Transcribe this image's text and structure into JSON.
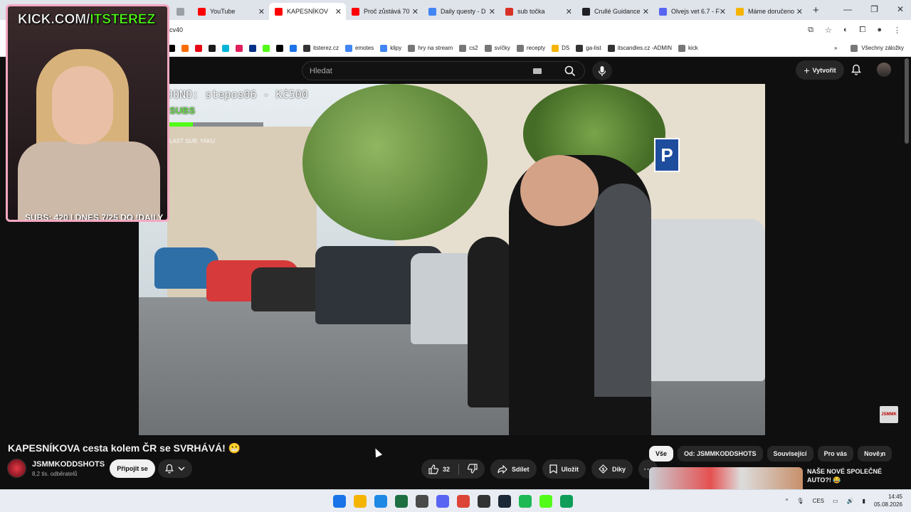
{
  "browser": {
    "tabs": [
      {
        "title": "",
        "favicon_color": "#9aa0a6"
      },
      {
        "title": "YouTube",
        "favicon_color": "#ff0000"
      },
      {
        "title": "KAPESNÍKOV",
        "favicon_color": "#ff0000",
        "active": true
      },
      {
        "title": "Proč zůstává 70",
        "favicon_color": "#ff0000"
      },
      {
        "title": "Daily questy - D",
        "favicon_color": "#4285f4"
      },
      {
        "title": "sub točka",
        "favicon_color": "#d93025"
      },
      {
        "title": "Crullé Guidance",
        "favicon_color": "#202124"
      },
      {
        "title": "Olvejs vet 6.7 - F",
        "favicon_color": "#5865f2"
      },
      {
        "title": "Máme doručeno",
        "favicon_color": "#f4b400"
      }
    ],
    "new_tab": "+",
    "window_controls": {
      "minimize": "—",
      "restore": "❐",
      "close": "✕"
    },
    "url": "cv40",
    "bookmarks": [
      {
        "label": "",
        "color": "#000000"
      },
      {
        "label": "",
        "color": "#ff6d00"
      },
      {
        "label": "",
        "color": "#e50914"
      },
      {
        "label": "",
        "color": "#1a1a1a"
      },
      {
        "label": "",
        "color": "#00b4d8"
      },
      {
        "label": "",
        "color": "#e01e5a"
      },
      {
        "label": "",
        "color": "#003087"
      },
      {
        "label": "",
        "color": "#53fc18"
      },
      {
        "label": "",
        "color": "#000000"
      },
      {
        "label": "",
        "color": "#1a73e8"
      },
      {
        "label": "itsterez.cz",
        "color": "#333333"
      },
      {
        "label": "emotes",
        "color": "#4285f4"
      },
      {
        "label": "klipy",
        "color": "#4285f4"
      },
      {
        "label": "hry na stream",
        "color": "#777777"
      },
      {
        "label": "cs2",
        "color": "#777777"
      },
      {
        "label": "svíčky",
        "color": "#777777"
      },
      {
        "label": "recepty",
        "color": "#777777"
      },
      {
        "label": "DS",
        "color": "#f4b400"
      },
      {
        "label": "ga-list",
        "color": "#333333"
      },
      {
        "label": "itscandles.cz -ADMIN",
        "color": "#333333"
      },
      {
        "label": "kick",
        "color": "#777777"
      }
    ],
    "bookmarks_more": "»",
    "all_bookmarks": "Všechny záložky"
  },
  "youtube": {
    "search_placeholder": "Hledat",
    "create_label": "Vytvořit",
    "video_title": "KAPESNÍKOVA cesta kolem ČR se SVRHÁVÁ! 😬",
    "channel_name": "JSMMKODDSHOTS",
    "channel_subs": "8,2 tis. odběratelů",
    "join_label": "Připojit se",
    "like_count": "32",
    "share_label": "Sdílet",
    "save_label": "Uložit",
    "thanks_label": "Díky",
    "chips": [
      "Vše",
      "Od: JSMMKODDSHOTS",
      "Související",
      "Pro vás",
      "Nově n"
    ],
    "rec_title": "NAŠE NOVÉ SPOLEČNÉ AUTO?! 😂",
    "mini_thumb_label": "JSMMK"
  },
  "stream_overlay": {
    "kick_title_white": "KICK.COM/",
    "kick_title_green": "ITSTEREZ",
    "donation_text": "DONO: stepos06 - Kč500",
    "subs_goal": "SUBS",
    "subs_goal_progress": 0.25,
    "last_sub": "LAST SUB: YAKU",
    "subs_line": "SUBS: 420 | DNES 7/25 DO !DAILY"
  },
  "video_scene": {
    "parking_sign": "P"
  },
  "taskbar": {
    "icons": [
      {
        "name": "windows-start-icon",
        "color": "#1a73e8"
      },
      {
        "name": "file-explorer-icon",
        "color": "#f4b400"
      },
      {
        "name": "app-c-icon",
        "color": "#1e88e5"
      },
      {
        "name": "excel-icon",
        "color": "#1d6f42"
      },
      {
        "name": "minecraft-icon",
        "color": "#4a4a4a"
      },
      {
        "name": "discord-icon",
        "color": "#5865f2"
      },
      {
        "name": "chrome-icon",
        "color": "#db4437"
      },
      {
        "name": "obs-icon",
        "color": "#333333"
      },
      {
        "name": "steam-icon",
        "color": "#1b2838"
      },
      {
        "name": "spotify-icon",
        "color": "#1db954"
      },
      {
        "name": "kick-icon",
        "color": "#53fc18"
      },
      {
        "name": "drive-icon",
        "color": "#0f9d58"
      }
    ],
    "lang": "CES",
    "time": "14:45",
    "date": "05.08.2026",
    "tray_up": "^"
  }
}
